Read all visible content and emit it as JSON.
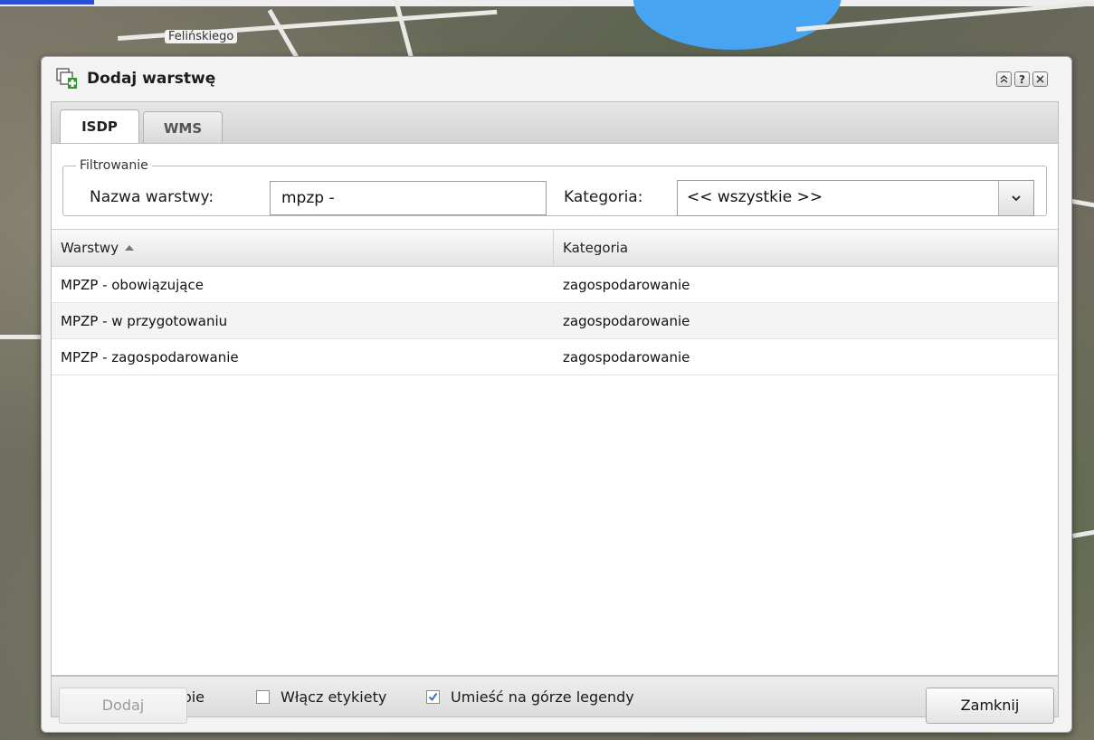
{
  "map": {
    "street_label": "Felińskiego"
  },
  "dialog": {
    "title": "Dodaj warstwę",
    "tools": {
      "collapse_icon": "double-chevron-up-icon",
      "help_label": "?",
      "close_icon": "close-icon"
    },
    "tabs": [
      {
        "label": "ISDP",
        "active": true
      },
      {
        "label": "WMS",
        "active": false
      }
    ],
    "filter": {
      "legend": "Filtrowanie",
      "name_label": "Nazwa warstwy:",
      "name_value": "mpzp -",
      "category_label": "Kategoria:",
      "category_value": "<< wszystkie >>"
    },
    "grid": {
      "columns": [
        "Warstwy",
        "Kategoria"
      ],
      "sort_column": "Warstwy",
      "sort_direction": "asc",
      "rows": [
        {
          "layer": "MPZP - obowiązujące",
          "category": "zagospodarowanie"
        },
        {
          "layer": "MPZP - w przygotowaniu",
          "category": "zagospodarowanie"
        },
        {
          "layer": "MPZP - zagospodarowanie",
          "category": "zagospodarowanie"
        }
      ]
    },
    "options": [
      {
        "label": "Pokaż na mapie",
        "checked": true
      },
      {
        "label": "Włącz etykiety",
        "checked": false
      },
      {
        "label": "Umieść na górze legendy",
        "checked": true
      }
    ],
    "buttons": {
      "add": "Dodaj",
      "add_disabled": true,
      "close": "Zamknij"
    },
    "colors": {
      "accent_check": "#3a6fc4",
      "add_icon_green": "#2e9a2e"
    }
  }
}
